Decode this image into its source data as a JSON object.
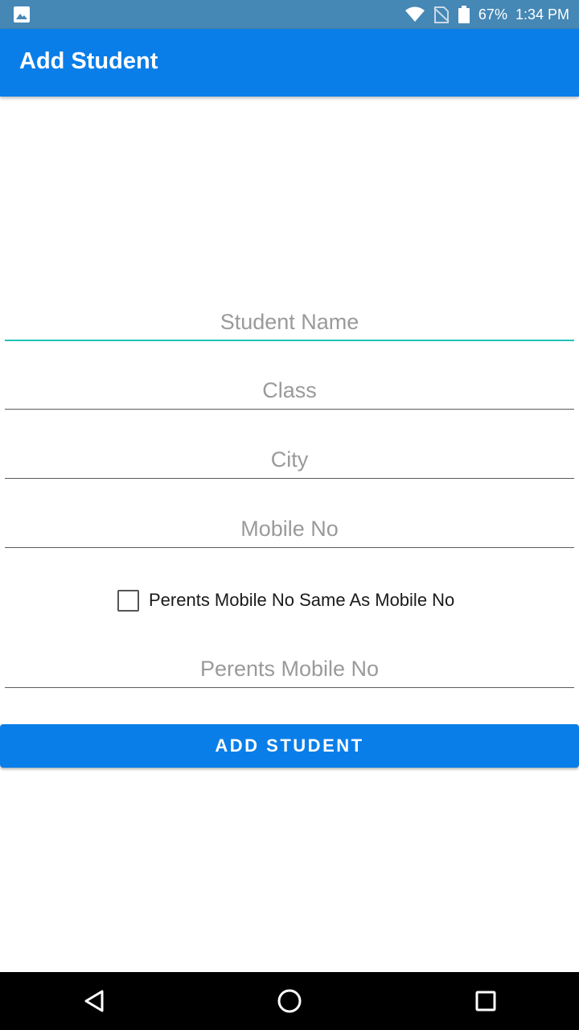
{
  "status_bar": {
    "battery": "67%",
    "time": "1:34 PM",
    "icons": [
      "image-icon",
      "wifi-icon",
      "no-sim-icon",
      "battery-icon"
    ]
  },
  "app_bar": {
    "title": "Add Student"
  },
  "form": {
    "student_name": {
      "placeholder": "Student Name",
      "value": ""
    },
    "class": {
      "placeholder": "Class",
      "value": ""
    },
    "city": {
      "placeholder": "City",
      "value": ""
    },
    "mobile_no": {
      "placeholder": "Mobile No",
      "value": ""
    },
    "same_checkbox": {
      "label": "Perents Mobile No Same As Mobile No",
      "checked": false
    },
    "parents_mobile_no": {
      "placeholder": "Perents Mobile No",
      "value": ""
    },
    "submit_label": "ADD STUDENT"
  },
  "nav_bar": {
    "icons": [
      "back-icon",
      "home-icon",
      "recents-icon"
    ]
  },
  "colors": {
    "primary": "#0a7ee8",
    "status_bar": "#4587b5",
    "focus_underline": "#20c3b6"
  }
}
